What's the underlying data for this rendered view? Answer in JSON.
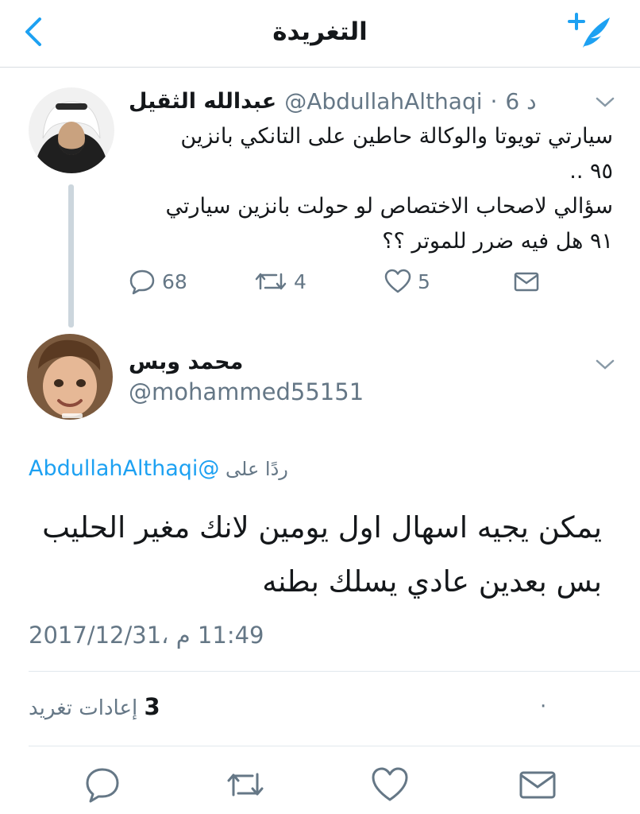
{
  "header": {
    "title": "التغريدة"
  },
  "parent_tweet": {
    "name": "عبدالله الثقيل",
    "handle": "@AbdullahAlthaqi",
    "separator": "·",
    "time": "6 د",
    "text_lines": [
      "سيارتي تويوتا والوكالة حاطين على التانكي بانزين",
      "٩٥ ..",
      "سؤالي لاصحاب الاختصاص لو حولت بانزين سيارتي",
      "٩١ هل فيه ضرر للموتر ؟؟"
    ],
    "actions": {
      "replies": "68",
      "retweets": "4",
      "likes": "5"
    }
  },
  "main_tweet": {
    "name": "محمد وبس",
    "handle": "@mohammed55151",
    "reply_label": "ردًا على",
    "reply_to_handle": "@AbdullahAlthaqi",
    "text_lines": [
      "يمكن يجيه اسهال اول يومين لانك مغير الحليب",
      "بس بعدين عادي يسلك بطنه"
    ],
    "timestamp": "11:49 م ،2017/12/31",
    "retweets_count": "3",
    "retweets_label": "إعادات تغريد",
    "stats_dot": "·"
  },
  "colors": {
    "accent": "#1da1f2",
    "secondary_text": "#657786",
    "divider": "#e1e8ed"
  },
  "icons": [
    "back-chevron",
    "compose-quill-plus",
    "chevron-down",
    "reply-bubble",
    "retweet",
    "heart",
    "envelope"
  ]
}
